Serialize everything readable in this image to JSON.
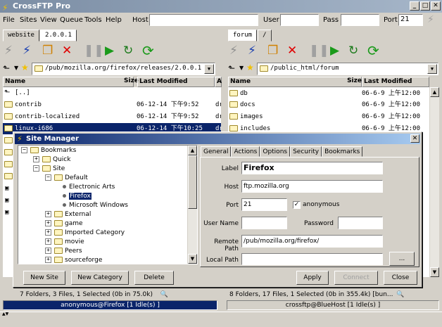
{
  "window": {
    "title": "CrossFTP Pro"
  },
  "menu": [
    "File",
    "Sites",
    "View",
    "Queue",
    "Tools",
    "Help"
  ],
  "quickconnect": {
    "host_label": "Host",
    "host_value": "",
    "user_label": "User",
    "user_value": "",
    "pass_label": "Pass",
    "pass_value": "",
    "port_label": "Port",
    "port_value": "21"
  },
  "left": {
    "tabs": [
      "website",
      "2.0.0.1"
    ],
    "active_tab": 1,
    "path": "/pub/mozilla.org/firefox/releases/2.0.0.1",
    "columns": [
      "Name",
      "Size",
      "Last Modified",
      "A"
    ],
    "rows": [
      {
        "name": "[..]",
        "size": "",
        "modified": "",
        "attr": ""
      },
      {
        "name": "contrib",
        "size": "",
        "modified": "06-12-14 下午9:52",
        "attr": "dr"
      },
      {
        "name": "contrib-localized",
        "size": "",
        "modified": "06-12-14 下午9:52",
        "attr": "dr"
      },
      {
        "name": "linux-i686",
        "size": "",
        "modified": "06-12-14 下午10:25",
        "attr": "dr"
      }
    ],
    "status": "7 Folders, 3 Files, 1 Selected (0b in 75.0k)",
    "connection": "anonymous@Firefox [1 Idle(s) ]"
  },
  "right": {
    "tabs": [
      "forum",
      "/"
    ],
    "active_tab": 0,
    "path": "/public_html/forum",
    "columns": [
      "Name",
      "Size",
      "Last Modified"
    ],
    "rows": [
      {
        "name": "db",
        "modified": "06-6-9 上午12:00"
      },
      {
        "name": "docs",
        "modified": "06-6-9 上午12:00"
      },
      {
        "name": "images",
        "modified": "06-6-9 上午12:00"
      },
      {
        "name": "includes",
        "modified": "06-6-9 上午12:00"
      }
    ],
    "status": "8 Folders, 17 Files, 1 Selected (0b in 355.4k) [bun...",
    "connection": "crossftp@BlueHost [1 Idle(s) ]"
  },
  "site_manager": {
    "title": "Site Manager",
    "tree": [
      {
        "label": "Bookmarks",
        "depth": 0,
        "expander": "−",
        "kind": "folder"
      },
      {
        "label": "Quick",
        "depth": 1,
        "expander": "+",
        "kind": "folder"
      },
      {
        "label": "Site",
        "depth": 1,
        "expander": "−",
        "kind": "folder"
      },
      {
        "label": "Default",
        "depth": 2,
        "expander": "−",
        "kind": "folder"
      },
      {
        "label": "Electronic Arts",
        "depth": 3,
        "expander": "",
        "kind": "site"
      },
      {
        "label": "Firefox",
        "depth": 3,
        "expander": "",
        "kind": "site",
        "selected": true
      },
      {
        "label": "Microsoft Windows",
        "depth": 3,
        "expander": "",
        "kind": "site"
      },
      {
        "label": "External",
        "depth": 2,
        "expander": "+",
        "kind": "folder"
      },
      {
        "label": "game",
        "depth": 2,
        "expander": "+",
        "kind": "folder"
      },
      {
        "label": "Imported Category",
        "depth": 2,
        "expander": "+",
        "kind": "folder"
      },
      {
        "label": "movie",
        "depth": 2,
        "expander": "+",
        "kind": "folder"
      },
      {
        "label": "Peers",
        "depth": 2,
        "expander": "+",
        "kind": "folder"
      },
      {
        "label": "sourceforge",
        "depth": 2,
        "expander": "+",
        "kind": "folder"
      }
    ],
    "tabs": [
      "General",
      "Actions",
      "Options",
      "Security",
      "Bookmarks"
    ],
    "fields": {
      "label_label": "Label",
      "label_value": "Firefox",
      "host_label": "Host",
      "host_value": "ftp.mozilla.org",
      "port_label": "Port",
      "port_value": "21",
      "anonymous_label": "anonymous",
      "anonymous_checked": "✓",
      "username_label": "User Name",
      "username_value": "",
      "password_label": "Password",
      "password_value": "",
      "remote_path_label": "Remote Path",
      "remote_path_value": "/pub/mozilla.org/firefox/",
      "local_path_label": "Local Path",
      "local_path_value": "",
      "browse_label": "..."
    },
    "buttons": {
      "new_site": "New Site",
      "new_category": "New Category",
      "delete": "Delete",
      "apply": "Apply",
      "connect": "Connect",
      "close": "Close"
    }
  },
  "icons": {
    "app": "lightning-icon",
    "connect": "plug-icon",
    "stop": "red-x-icon",
    "pause": "pause-icon",
    "play": "play-icon",
    "refresh": "refresh-icon",
    "sync": "green-refresh-icon",
    "folder": "folder-icon",
    "star": "star-icon"
  }
}
